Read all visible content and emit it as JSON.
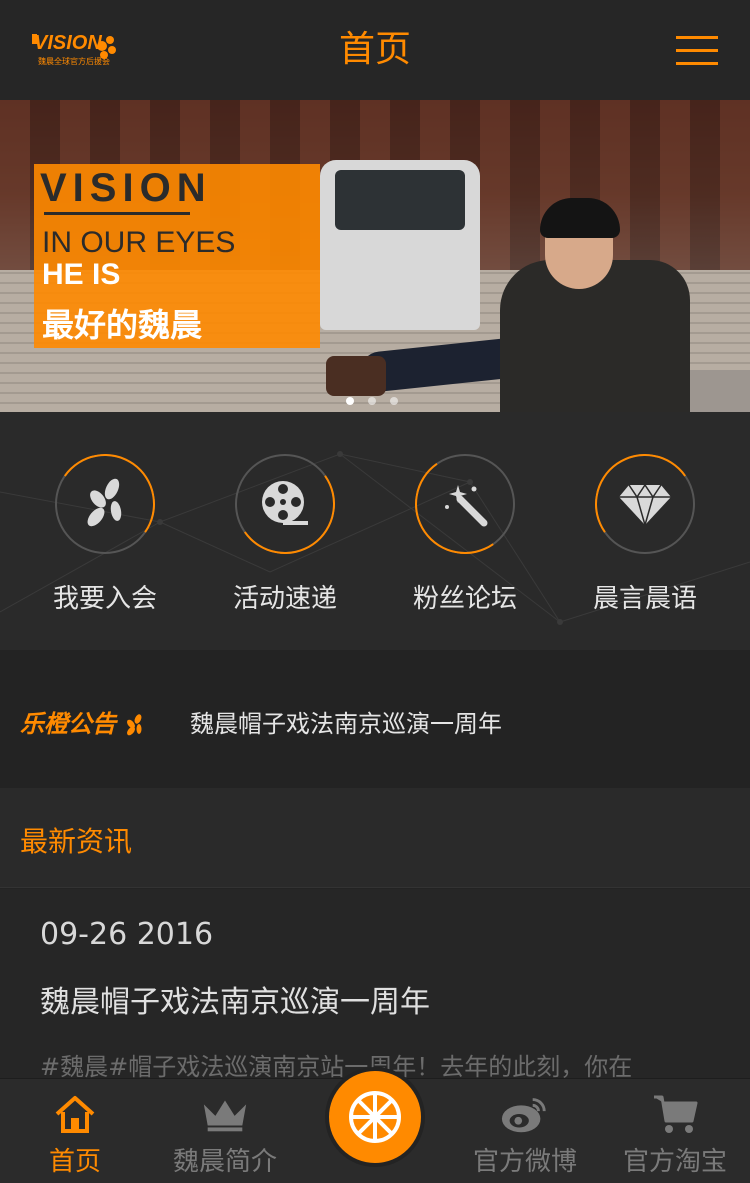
{
  "header": {
    "logo_text": "VISION",
    "logo_sub": "魏晨全球官方后援会",
    "title": "首页",
    "menu_icon": "hamburger-menu-icon"
  },
  "banner": {
    "line1": "VISION",
    "line2": "IN OUR EYES",
    "line3": "HE IS",
    "line4": "最好的魏晨",
    "slide_count": 3,
    "active_slide": 1
  },
  "categories": [
    {
      "label": "我要入会",
      "icon": "butterfly-icon"
    },
    {
      "label": "活动速递",
      "icon": "film-reel-icon"
    },
    {
      "label": "粉丝论坛",
      "icon": "magic-wand-icon"
    },
    {
      "label": "晨言晨语",
      "icon": "diamond-icon"
    }
  ],
  "notice": {
    "tag": "乐橙公告",
    "text": "魏晨帽子戏法南京巡演一周年"
  },
  "news": {
    "section_title": "最新资讯",
    "items": [
      {
        "date": "09-26 2016",
        "title": "魏晨帽子戏法南京巡演一周年",
        "excerpt": "#魏晨#帽子戏法巡演南京站一周年！去年的此刻，你在"
      }
    ]
  },
  "tabbar": {
    "tabs": [
      {
        "label": "首页",
        "icon": "home-icon",
        "active": true
      },
      {
        "label": "魏晨简介",
        "icon": "crown-icon",
        "active": false
      },
      {
        "label": "",
        "icon": "orange-slice-icon",
        "active": false
      },
      {
        "label": "官方微博",
        "icon": "weibo-icon",
        "active": false
      },
      {
        "label": "官方淘宝",
        "icon": "shopping-cart-icon",
        "active": false
      }
    ]
  },
  "colors": {
    "accent": "#ff8a00",
    "background": "#232323",
    "text": "#e5e5e5"
  }
}
